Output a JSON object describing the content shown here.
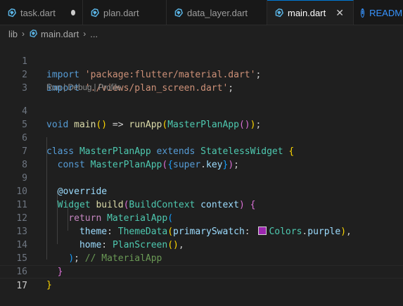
{
  "tabs": [
    {
      "label": "task.dart",
      "modified": true
    },
    {
      "label": "plan.dart"
    },
    {
      "label": "data_layer.dart"
    },
    {
      "label": "main.dart",
      "active": true
    },
    {
      "label": "READM",
      "type": "info"
    }
  ],
  "breadcrumb": {
    "folder": "lib",
    "file": "main.dart",
    "more": "..."
  },
  "codelens": "Run | Debug | Profile",
  "colors": {
    "accent": "#0078d4",
    "swatch_purple": "#9c27b0",
    "dart_icon": "#5ab4e5"
  },
  "icons": {
    "file": "dart-file-icon",
    "close": "close-icon",
    "modified": "modified-dot-icon",
    "info": "info-icon"
  },
  "code": {
    "line_numbers": [
      "1",
      "2",
      "3",
      "4",
      "5",
      "6",
      "7",
      "8",
      "9",
      "10",
      "11",
      "12",
      "13",
      "14",
      "15",
      "16",
      "17"
    ],
    "current_line": 17,
    "l1": {
      "kw": "import",
      "str": "'package:flutter/material.dart'",
      "end": ";"
    },
    "l2": {
      "kw": "import",
      "str": "'./views/plan_screen.dart'",
      "end": ";"
    },
    "l4": {
      "kw": "void",
      "fn": "main",
      "p1": "()",
      "arrow": " => ",
      "fn2": "runApp",
      "p2": "(",
      "cls": "MasterPlanApp",
      "p3": "()",
      "p4": ")",
      "end": ";"
    },
    "l6": {
      "kw": "class",
      "cls": "MasterPlanApp",
      "kw2": "extends",
      "cls2": "StatelessWidget",
      "br": "{"
    },
    "l7": {
      "kw": "const",
      "cls": "MasterPlanApp",
      "p1": "(",
      "p2": "{",
      "kw2": "super",
      "dot": ".",
      "var": "key",
      "p3": "}",
      "p4": ")",
      "end": ";"
    },
    "l9": {
      "ann": "@override"
    },
    "l10": {
      "cls": "Widget",
      "fn": "build",
      "p1": "(",
      "cls2": "BuildContext",
      "var": "context",
      "p2": ")",
      "br": "{"
    },
    "l11": {
      "kw": "return",
      "cls": "MaterialApp",
      "p1": "("
    },
    "l12": {
      "var": "theme",
      "colon": ":",
      "cls": "ThemeData",
      "p1": "(",
      "var2": "primarySwatch",
      "colon2": ":",
      "cls2": "Colors",
      "dot": ".",
      "var3": "purple",
      "p2": ")",
      "end": ","
    },
    "l13": {
      "var": "home",
      "colon": ":",
      "cls": "PlanScreen",
      "p1": "()",
      "end": ","
    },
    "l14": {
      "p1": ")",
      "end": ";",
      "com": "// MaterialApp"
    },
    "l15": {
      "br": "}"
    },
    "l16": {
      "br": "}"
    }
  }
}
